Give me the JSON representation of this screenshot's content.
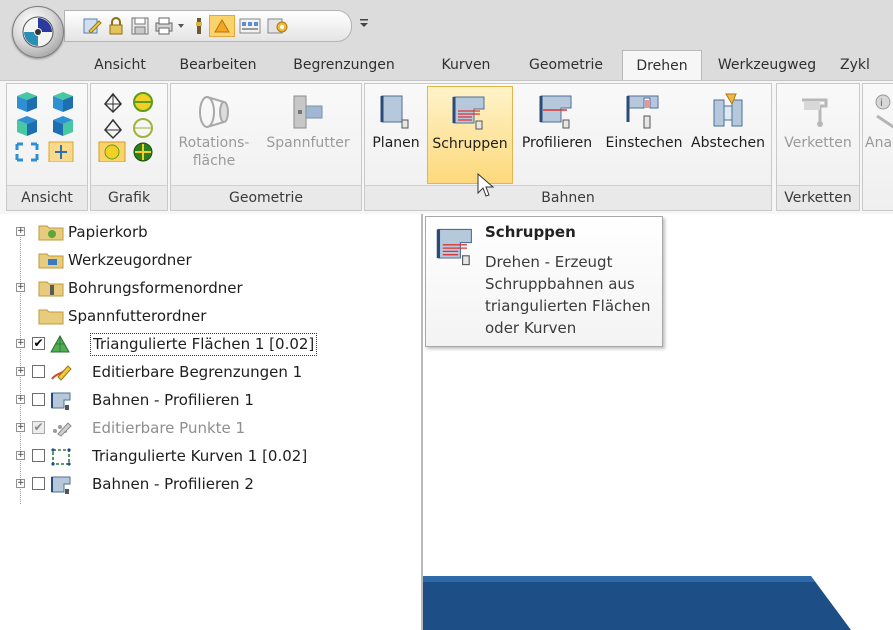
{
  "quick_access": {
    "icons": [
      "app-orb-icon",
      "edit-icon",
      "lock-icon",
      "save-icon",
      "print-icon",
      "dropdown-icon",
      "settings-icon",
      "lathe-icon",
      "toolbar-icon",
      "gear-icon",
      "customize-icon"
    ]
  },
  "tabs": [
    {
      "label": "Ansicht"
    },
    {
      "label": "Bearbeiten"
    },
    {
      "label": "Begrenzungen"
    },
    {
      "label": "Kurven"
    },
    {
      "label": "Geometrie"
    },
    {
      "label": "Drehen",
      "active": true
    },
    {
      "label": "Werkzeugweg"
    },
    {
      "label": "Zykl"
    }
  ],
  "ribbon": {
    "groups": {
      "ansicht": "Ansicht",
      "grafik": "Grafik",
      "geometrie": "Geometrie",
      "bahnen": "Bahnen",
      "verketten": "Verketten"
    },
    "geometrie_buttons": {
      "rotationsflaeche_1": "Rotations-",
      "rotationsflaeche_2": "fläche",
      "spannfutter": "Spannfutter"
    },
    "bahnen_buttons": {
      "planen": "Planen",
      "schruppen": "Schruppen",
      "profilieren": "Profilieren",
      "einstechen": "Einstechen",
      "abstechen": "Abstechen"
    },
    "verketten_buttons": {
      "verketten": "Verketten",
      "ana": "Ana"
    }
  },
  "tree": {
    "items": [
      {
        "label": "Papierkorb",
        "expandable": true,
        "checkbox": null
      },
      {
        "label": "Werkzeugordner",
        "expandable": false,
        "checkbox": null
      },
      {
        "label": "Bohrungsformenordner",
        "expandable": true,
        "checkbox": null
      },
      {
        "label": "Spannfutterordner",
        "expandable": false,
        "checkbox": null
      },
      {
        "label": "Triangulierte Flächen 1 [0.02]",
        "expandable": true,
        "checkbox": "checked",
        "selected": true
      },
      {
        "label": "Editierbare Begrenzungen 1",
        "expandable": true,
        "checkbox": "unchecked"
      },
      {
        "label": "Bahnen - Profilieren 1",
        "expandable": true,
        "checkbox": "unchecked"
      },
      {
        "label": "Editierbare Punkte 1",
        "expandable": true,
        "checkbox": "checked-greyed",
        "greyed": true
      },
      {
        "label": "Triangulierte Kurven 1 [0.02]",
        "expandable": true,
        "checkbox": "unchecked"
      },
      {
        "label": "Bahnen - Profilieren 2",
        "expandable": true,
        "checkbox": "unchecked"
      }
    ]
  },
  "tooltip": {
    "title": "Schruppen",
    "lines": [
      "Drehen - Erzeugt",
      "Schruppbahnen aus",
      "triangulierten Flächen",
      "oder Kurven"
    ]
  },
  "colors": {
    "ribbon_bg": "#f6f6f6",
    "hot_button": "#fcd97c",
    "viewport_model": "#1d4f86",
    "selection_outline": "#333333"
  }
}
